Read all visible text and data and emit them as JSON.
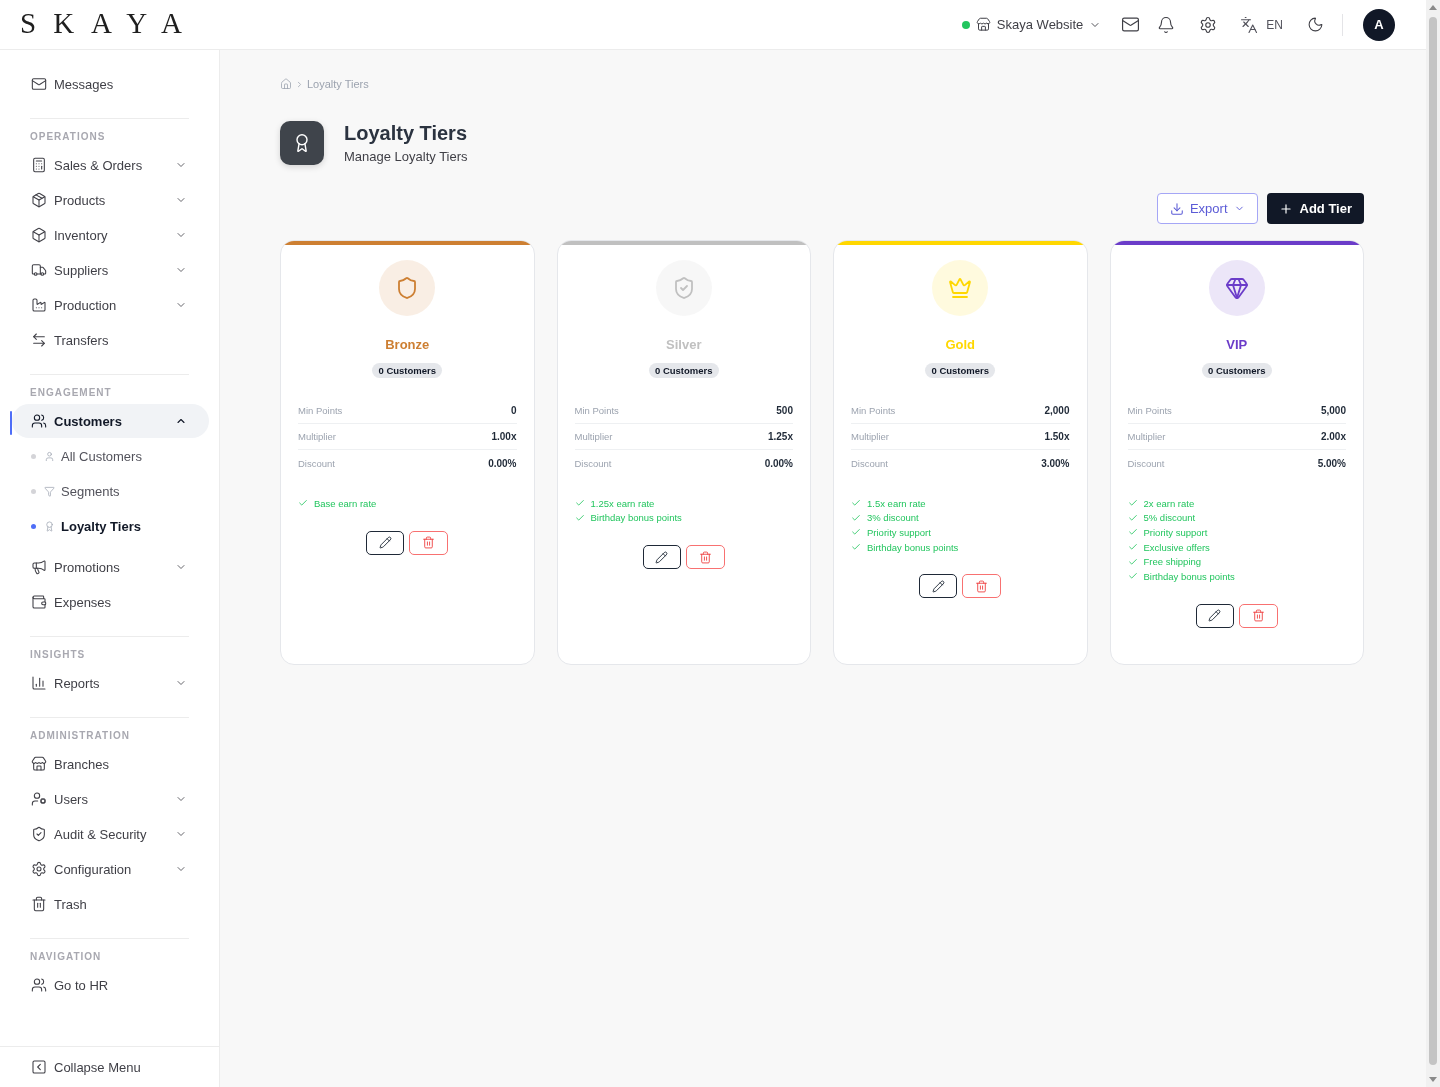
{
  "header": {
    "logo": "SKAYA",
    "store": {
      "label": "Skaya Website",
      "online": true
    },
    "language": "EN",
    "avatar": "A"
  },
  "sidebar": {
    "sections": [
      {
        "items": [
          {
            "label": "Messages",
            "selected": false
          }
        ]
      },
      {
        "title": "OPERATIONS",
        "items": [
          {
            "label": "Sales & Orders",
            "selected": false,
            "expanded": false
          },
          {
            "label": "Products",
            "selected": false,
            "expanded": false
          },
          {
            "label": "Inventory",
            "selected": false,
            "expanded": false
          },
          {
            "label": "Suppliers",
            "selected": false,
            "expanded": false
          },
          {
            "label": "Production",
            "selected": false,
            "expanded": false
          },
          {
            "label": "Transfers",
            "selected": false
          }
        ]
      },
      {
        "title": "ENGAGEMENT",
        "items": [
          {
            "label": "Customers",
            "selected": true,
            "expanded": true,
            "children": [
              {
                "label": "All Customers",
                "selected": false
              },
              {
                "label": "Segments",
                "selected": false
              },
              {
                "label": "Loyalty Tiers",
                "selected": true
              }
            ]
          },
          {
            "label": "Promotions",
            "selected": false,
            "expanded": false
          },
          {
            "label": "Expenses",
            "selected": false
          }
        ]
      },
      {
        "title": "INSIGHTS",
        "items": [
          {
            "label": "Reports",
            "selected": false,
            "expanded": false
          }
        ]
      },
      {
        "title": "ADMINISTRATION",
        "items": [
          {
            "label": "Branches",
            "selected": false
          },
          {
            "label": "Users",
            "selected": false,
            "expanded": false
          },
          {
            "label": "Audit & Security",
            "selected": false,
            "expanded": false
          },
          {
            "label": "Configuration",
            "selected": false,
            "expanded": false
          },
          {
            "label": "Trash",
            "selected": false
          }
        ]
      },
      {
        "title": "NAVIGATION",
        "items": [
          {
            "label": "Go to HR",
            "selected": false
          }
        ]
      }
    ],
    "footer": "Collapse Menu"
  },
  "breadcrumb": [
    "Loyalty Tiers"
  ],
  "page": {
    "title": "Loyalty Tiers",
    "subtitle": "Manage Loyalty Tiers"
  },
  "actions": [
    {
      "label": "Export",
      "kind": "outline"
    },
    {
      "label": "Add Tier",
      "kind": "primary"
    }
  ],
  "tiers": [
    {
      "name": "Bronze",
      "color": "#cd7f32",
      "customers": "0 Customers",
      "stats": [
        {
          "label": "Min Points",
          "value": "0"
        },
        {
          "label": "Multiplier",
          "value": "1.00x"
        },
        {
          "label": "Discount",
          "value": "0.00%"
        }
      ],
      "features": [
        "Base earn rate"
      ]
    },
    {
      "name": "Silver",
      "color": "#c0c0c0",
      "customers": "0 Customers",
      "stats": [
        {
          "label": "Min Points",
          "value": "500"
        },
        {
          "label": "Multiplier",
          "value": "1.25x"
        },
        {
          "label": "Discount",
          "value": "0.00%"
        }
      ],
      "features": [
        "1.25x earn rate",
        "Birthday bonus points"
      ]
    },
    {
      "name": "Gold",
      "color": "#ffd700",
      "customers": "0 Customers",
      "stats": [
        {
          "label": "Min Points",
          "value": "2,000"
        },
        {
          "label": "Multiplier",
          "value": "1.50x"
        },
        {
          "label": "Discount",
          "value": "3.00%"
        }
      ],
      "features": [
        "1.5x earn rate",
        "3% discount",
        "Priority support",
        "Birthday bonus points"
      ]
    },
    {
      "name": "VIP",
      "color": "#6b3cc9",
      "customers": "0 Customers",
      "stats": [
        {
          "label": "Min Points",
          "value": "5,000"
        },
        {
          "label": "Multiplier",
          "value": "2.00x"
        },
        {
          "label": "Discount",
          "value": "5.00%"
        }
      ],
      "features": [
        "2x earn rate",
        "5% discount",
        "Priority support",
        "Exclusive offers",
        "Free shipping",
        "Birthday bonus points"
      ]
    }
  ]
}
